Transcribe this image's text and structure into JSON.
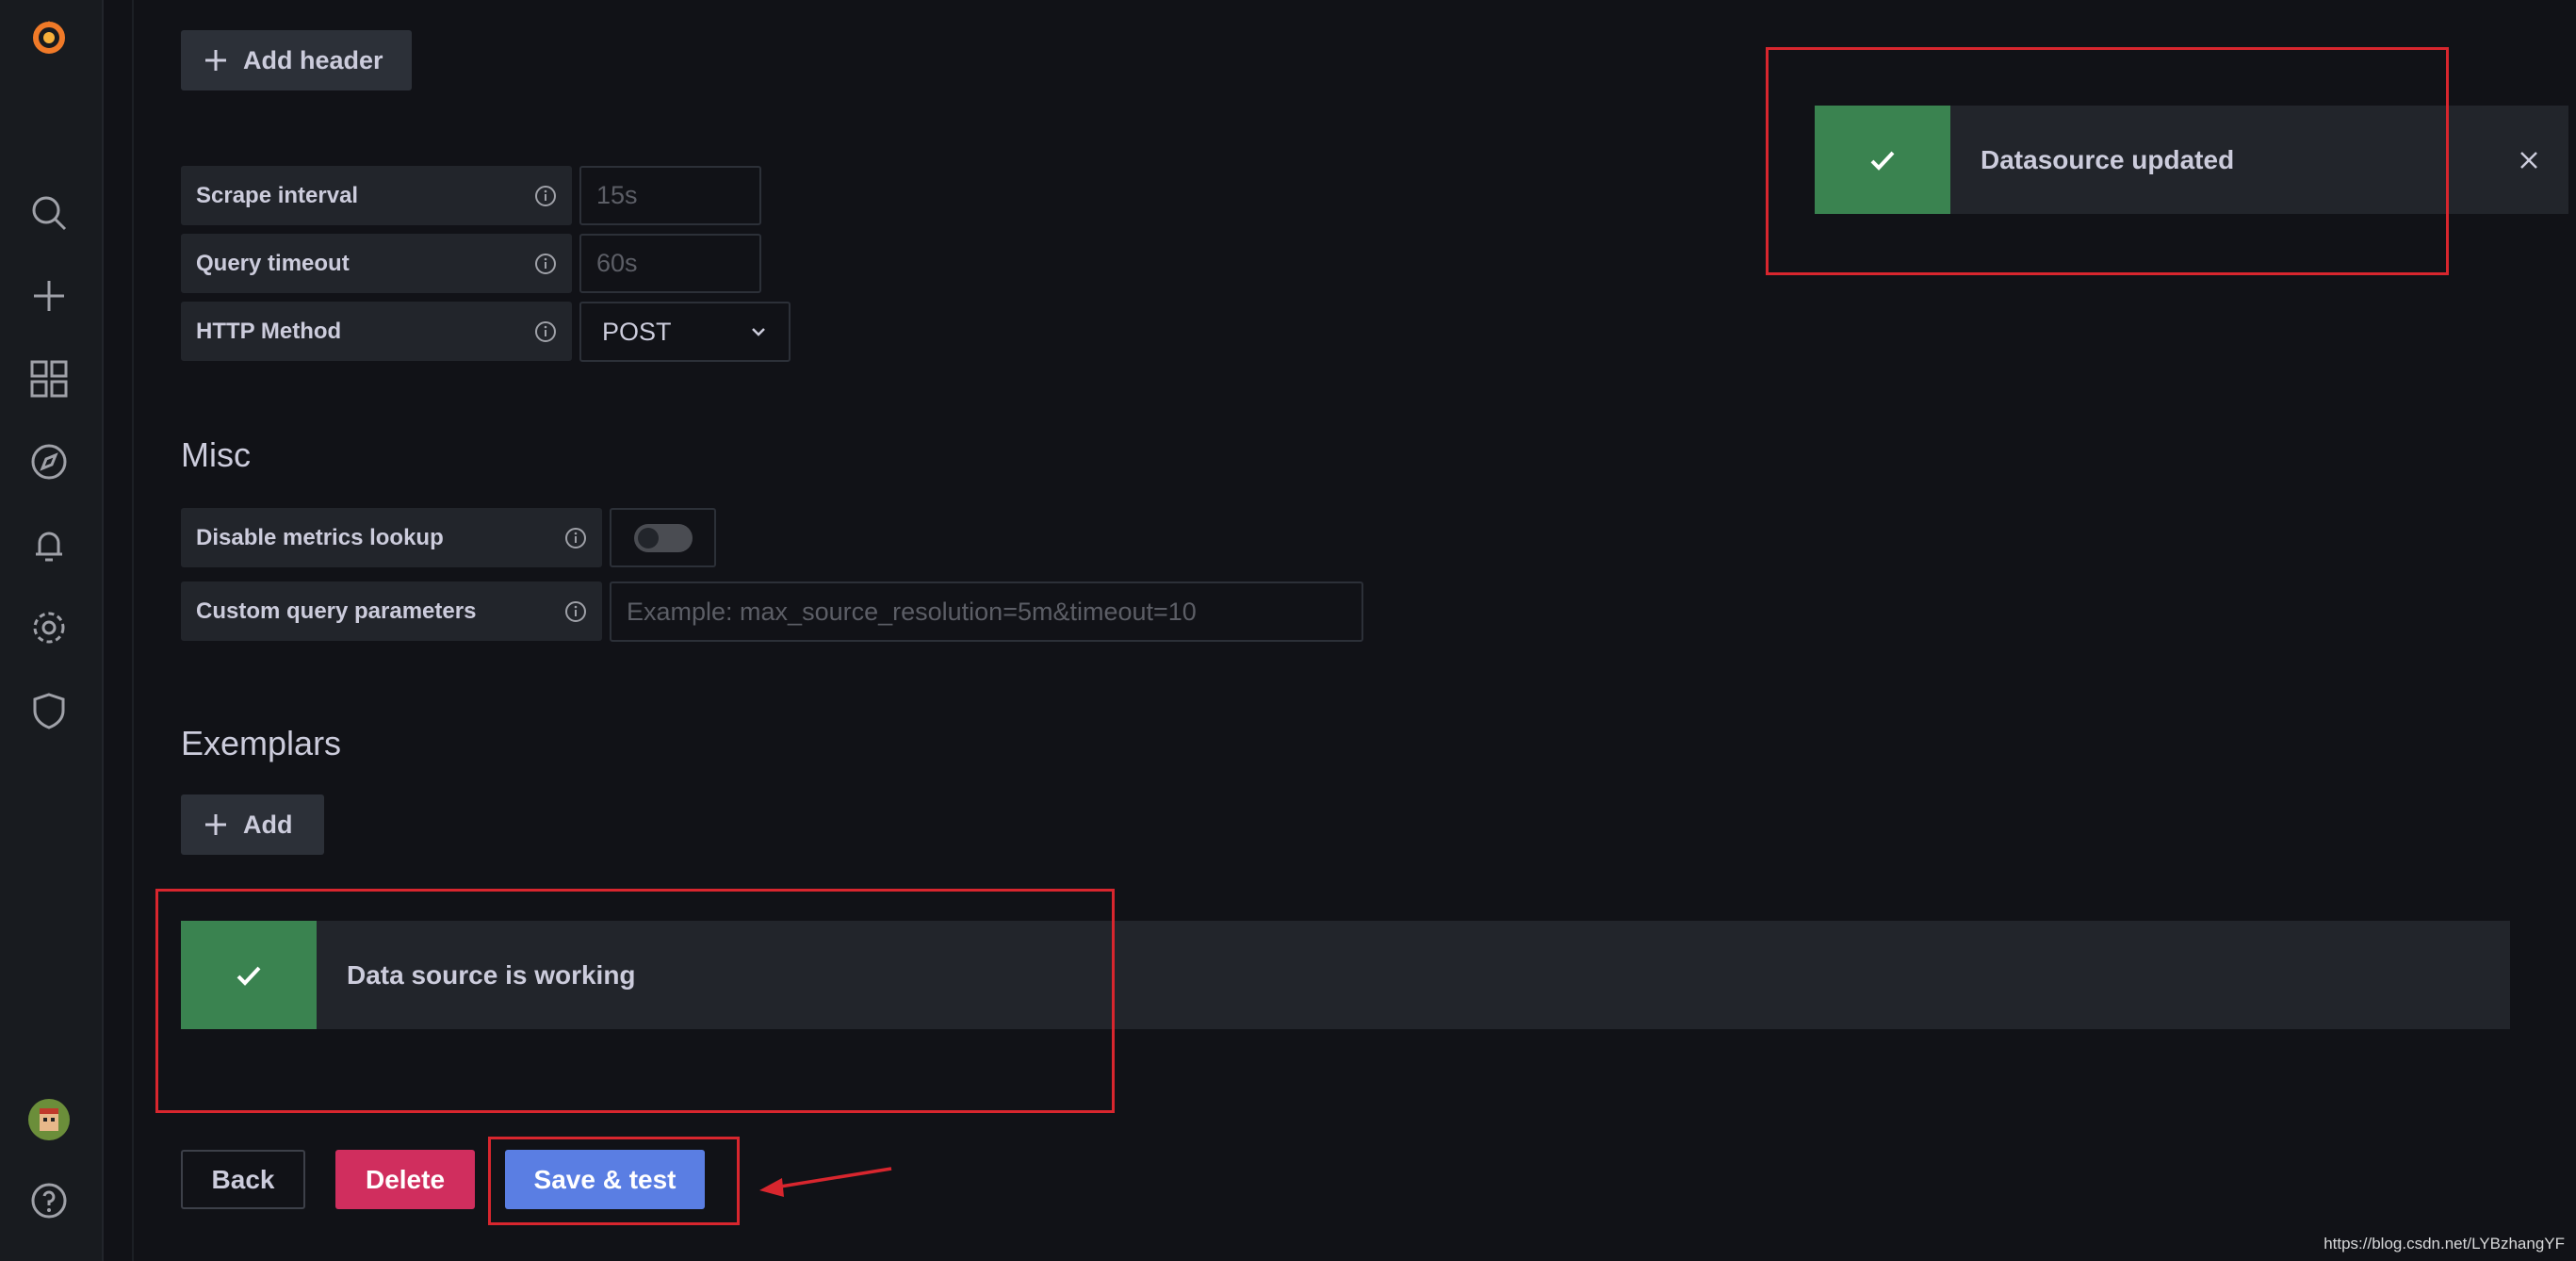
{
  "sidebar": {
    "icons": [
      "grafana-logo-icon",
      "search-icon",
      "plus-icon",
      "dashboards-icon",
      "explore-icon",
      "alerting-icon",
      "settings-icon",
      "shield-icon",
      "user-avatar",
      "help-icon"
    ]
  },
  "headers": {
    "add_header_label": "Add header"
  },
  "http": {
    "scrape_interval_label": "Scrape interval",
    "scrape_interval_placeholder": "15s",
    "query_timeout_label": "Query timeout",
    "query_timeout_placeholder": "60s",
    "http_method_label": "HTTP Method",
    "http_method_value": "POST"
  },
  "misc": {
    "title": "Misc",
    "disable_metrics_lookup_label": "Disable metrics lookup",
    "disable_metrics_lookup_enabled": false,
    "custom_query_params_label": "Custom query parameters",
    "custom_query_params_placeholder": "Example: max_source_resolution=5m&timeout=10"
  },
  "exemplars": {
    "title": "Exemplars",
    "add_label": "Add"
  },
  "test_result": {
    "message": "Data source is working"
  },
  "actions": {
    "back": "Back",
    "delete": "Delete",
    "save_test": "Save & test"
  },
  "toast": {
    "message": "Datasource updated"
  },
  "watermark": "https://blog.csdn.net/LYBzhangYF",
  "colors": {
    "success": "#3a8350",
    "danger": "#d02e5e",
    "primary": "#5a7ee3",
    "highlight": "#d8262e"
  }
}
